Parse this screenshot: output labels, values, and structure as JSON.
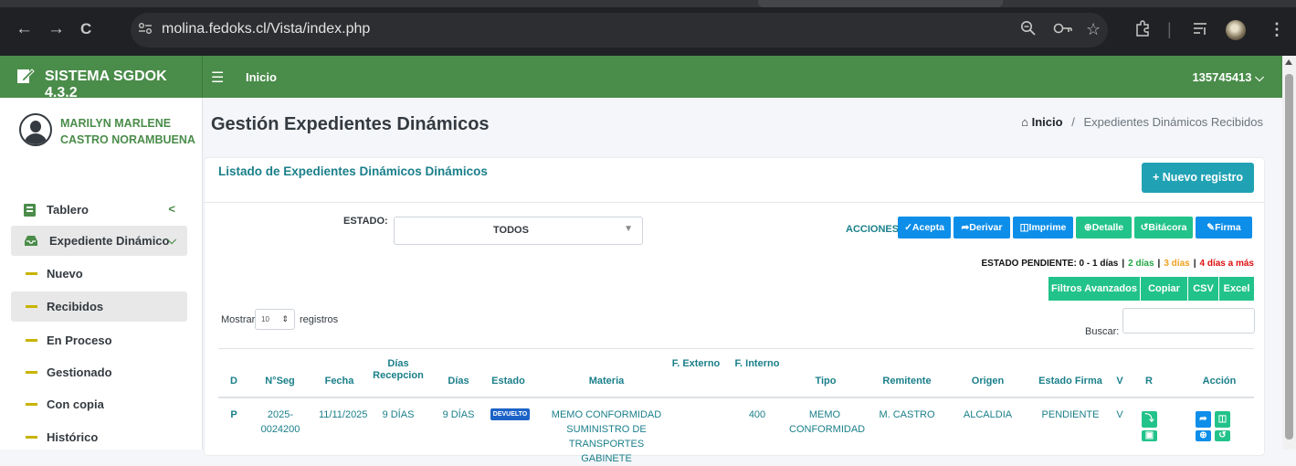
{
  "browser": {
    "url": "molina.fedoks.cl/Vista/index.php",
    "back_icon": "←",
    "forward_icon": "→",
    "reload_icon": "C",
    "site_info_icon": "⚲"
  },
  "header": {
    "brand": "SISTEMA SGDOK 4.3.2",
    "menu_icon": "☰",
    "inicio": "Inicio",
    "user_code": "135745413"
  },
  "sidebar": {
    "user_name": "MARILYN MARLENE CASTRO NORAMBUENA",
    "tablero": "Tablero",
    "expediente": "Expediente Dinámico",
    "items": [
      "Nuevo",
      "Recibidos",
      "En Proceso",
      "Gestionado",
      "Con copia",
      "Histórico"
    ]
  },
  "page": {
    "title": "Gestión Expedientes Dinámicos",
    "breadcrumb_home": "Inicio",
    "breadcrumb_sep": "/",
    "breadcrumb_current": "Expedientes Dinámicos Recibidos"
  },
  "card": {
    "title": "Listado de Expedientes Dinámicos Dinámicos",
    "nuevo_btn": "Nuevo registro",
    "estado_label": "ESTADO:",
    "estado_value": "TODOS",
    "acciones_label": "ACCIONES:",
    "acciones": [
      "Acepta",
      "Derivar",
      "Imprime",
      "Detalle",
      "Bitácora",
      "Firma"
    ],
    "estado_pendiente_label": "ESTADO PENDIENTE: 0 - 1 días",
    "ep_2": "2 días",
    "ep_3": "3 días",
    "ep_4": "4 días a más",
    "ep_sep": "|",
    "export_buttons": [
      "Filtros Avanzados",
      "Copiar",
      "CSV",
      "Excel"
    ],
    "mostrar": "Mostrar",
    "length_value": "10",
    "registros": "registros",
    "buscar": "Buscar:"
  },
  "table": {
    "headers": [
      "D",
      "N°Seg",
      "Fecha",
      "Días Recepcion",
      "Días",
      "Estado",
      "Materia",
      "F. Externo",
      "F. Interno",
      "Tipo",
      "Remitente",
      "Origen",
      "Estado Firma",
      "V",
      "R",
      "Acción"
    ],
    "rows": [
      {
        "d": "P",
        "nseg": "2025-0024200",
        "fecha": "11/11/2025",
        "dias_recepcion": "9 DÍAS",
        "dias": "9 DÍAS",
        "estado": "DEVUELTO",
        "materia": "MEMO CONFORMIDAD SUMINISTRO DE TRANSPORTES GABINETE",
        "f_externo": "",
        "f_interno": "400",
        "tipo": "MEMO CONFORMIDAD",
        "remitente": "M. CASTRO",
        "origen": "ALCALDIA",
        "estado_firma": "PENDIENTE",
        "v": "V"
      }
    ]
  }
}
